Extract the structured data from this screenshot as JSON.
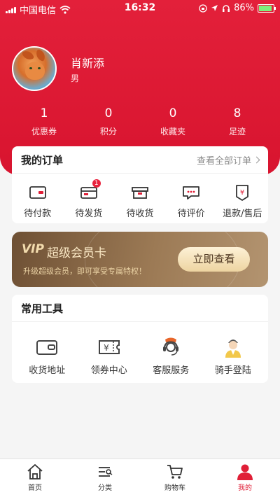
{
  "status_bar": {
    "carrier": "中国电信",
    "time": "16:32",
    "battery": "86%"
  },
  "profile": {
    "name": "肖新添",
    "gender": "男"
  },
  "stats": [
    {
      "value": "1",
      "label": "优惠券"
    },
    {
      "value": "0",
      "label": "积分"
    },
    {
      "value": "0",
      "label": "收藏夹"
    },
    {
      "value": "8",
      "label": "足迹"
    }
  ],
  "orders": {
    "title": "我的订单",
    "view_all": "查看全部订单",
    "items": [
      {
        "label": "待付款",
        "icon": "wallet-icon"
      },
      {
        "label": "待发货",
        "icon": "card-icon",
        "badge": "1"
      },
      {
        "label": "待收货",
        "icon": "box-icon"
      },
      {
        "label": "待评价",
        "icon": "comment-icon"
      },
      {
        "label": "退款/售后",
        "icon": "refund-icon"
      }
    ]
  },
  "vip": {
    "logo": "VIP",
    "title": "超级会员卡",
    "subtitle": "升级超级会员，即可享受专属特权！",
    "button": "立即查看"
  },
  "tools": {
    "title": "常用工具",
    "items": [
      {
        "label": "收货地址",
        "icon": "address-wallet-icon"
      },
      {
        "label": "领券中心",
        "icon": "coupon-icon"
      },
      {
        "label": "客服服务",
        "icon": "customer-service-icon"
      },
      {
        "label": "骑手登陆",
        "icon": "rider-icon"
      }
    ]
  },
  "tabbar": {
    "items": [
      {
        "label": "首页",
        "icon": "home-icon"
      },
      {
        "label": "分类",
        "icon": "category-icon"
      },
      {
        "label": "购物车",
        "icon": "cart-icon"
      },
      {
        "label": "我的",
        "icon": "profile-icon",
        "active": true
      }
    ]
  },
  "colors": {
    "brand_red": "#e01f37",
    "vip_gold": "#9c7a55"
  }
}
